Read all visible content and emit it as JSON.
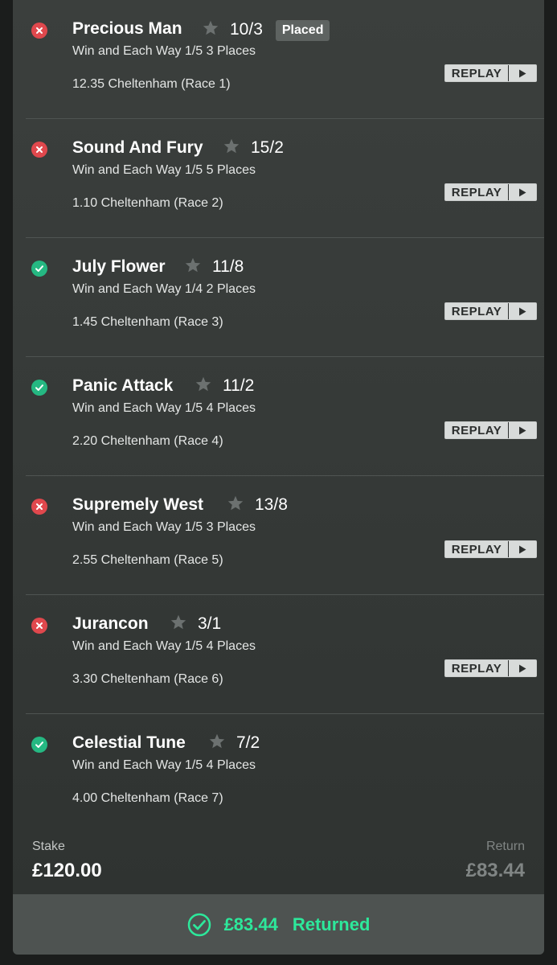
{
  "selections": [
    {
      "status": "lost",
      "horse": "Precious Man",
      "odds": "10/3",
      "badge": "Placed",
      "market": "Win and Each Way 1/5 3 Places",
      "race": "12.35 Cheltenham (Race 1)",
      "replay": "REPLAY"
    },
    {
      "status": "lost",
      "horse": "Sound And Fury",
      "odds": "15/2",
      "badge": "",
      "market": "Win and Each Way 1/5 5 Places",
      "race": "1.10 Cheltenham (Race 2)",
      "replay": "REPLAY"
    },
    {
      "status": "won",
      "horse": "July Flower",
      "odds": "11/8",
      "badge": "",
      "market": "Win and Each Way 1/4 2 Places",
      "race": "1.45 Cheltenham (Race 3)",
      "replay": "REPLAY"
    },
    {
      "status": "won",
      "horse": "Panic Attack",
      "odds": "11/2",
      "badge": "",
      "market": "Win and Each Way 1/5 4 Places",
      "race": "2.20 Cheltenham (Race 4)",
      "replay": "REPLAY"
    },
    {
      "status": "lost",
      "horse": "Supremely West",
      "odds": "13/8",
      "badge": "",
      "market": "Win and Each Way 1/5 3 Places",
      "race": "2.55 Cheltenham (Race 5)",
      "replay": "REPLAY"
    },
    {
      "status": "lost",
      "horse": "Jurancon",
      "odds": "3/1",
      "badge": "",
      "market": "Win and Each Way 1/5 4 Places",
      "race": "3.30 Cheltenham (Race 6)",
      "replay": "REPLAY"
    },
    {
      "status": "won",
      "horse": "Celestial Tune",
      "odds": "7/2",
      "badge": "",
      "market": "Win and Each Way 1/5 4 Places",
      "race": "4.00 Cheltenham (Race 7)",
      "replay": ""
    }
  ],
  "footer": {
    "stake_label": "Stake",
    "stake_value": "£120.00",
    "return_label": "Return",
    "return_value": "£83.44",
    "returned_amount": "£83.44",
    "returned_text": "Returned"
  },
  "colors": {
    "won": "#25b882",
    "lost": "#e0484d",
    "returned": "#2de89b"
  },
  "icons": {
    "lost": "cross-circle-icon",
    "won": "check-circle-icon",
    "favourite": "star-icon",
    "play": "play-icon",
    "returned": "check-circle-outline-icon"
  }
}
